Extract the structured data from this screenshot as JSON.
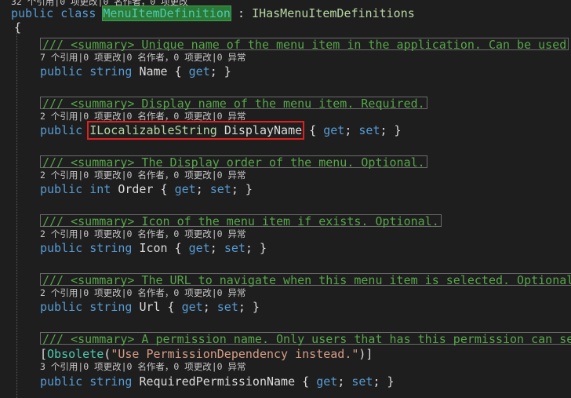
{
  "top_lens": "32 个引用|0 项更改|0 名作者，0 项更改",
  "class_line": {
    "kw_public": "public",
    "kw_class": "class",
    "class_name": "MenuItemDefinition",
    "colon": " : ",
    "interface": "IHasMenuItemDefinitions"
  },
  "open_brace": "{",
  "members": [
    {
      "doc": "/// <summary> Unique name of the menu item in the application. Can be used",
      "lens": "7 个引用|0 项更改|0 名作者，0 项更改|0 异常",
      "kw1": "public",
      "type": "string",
      "name": "Name",
      "accessors": "{ get; }",
      "acc_get": "get",
      "acc_set": ""
    },
    {
      "doc": "/// <summary> Display name of the menu item. Required.",
      "lens": "2 个引用|0 项更改|0 名作者，0 项更改|0 异常",
      "kw1": "public",
      "type": "ILocalizableString",
      "name": "DisplayName",
      "acc_get": "get",
      "acc_set": "set"
    },
    {
      "doc": "/// <summary> The Display order of the menu. Optional.",
      "lens": "2 个引用|0 项更改|0 名作者，0 项更改|0 异常",
      "kw1": "public",
      "type": "int",
      "name": "Order",
      "acc_get": "get",
      "acc_set": "set"
    },
    {
      "doc": "/// <summary> Icon of the menu item if exists. Optional.",
      "lens": "2 个引用|0 项更改|0 名作者，0 项更改|0 异常",
      "kw1": "public",
      "type": "string",
      "name": "Icon",
      "acc_get": "get",
      "acc_set": "set"
    },
    {
      "doc": "/// <summary> The URL to navigate when this menu item is selected. Optional",
      "lens": "2 个引用|0 项更改|0 名作者，0 项更改|0 异常",
      "kw1": "public",
      "type": "string",
      "name": "Url",
      "acc_get": "get",
      "acc_set": "set"
    },
    {
      "doc": "/// <summary> A permission name. Only users that has this permission can se",
      "attribute_open": "[",
      "attribute_name": "Obsolete",
      "attribute_paren_open": "(",
      "attribute_string": "\"Use PermissionDependency instead.\"",
      "attribute_close": ")]",
      "lens": "3 个引用|0 项更改|0 名作者，0 项更改|0 异常",
      "kw1": "public",
      "type": "string",
      "name": "RequiredPermissionName",
      "acc_get": "get",
      "acc_set": "set"
    }
  ]
}
